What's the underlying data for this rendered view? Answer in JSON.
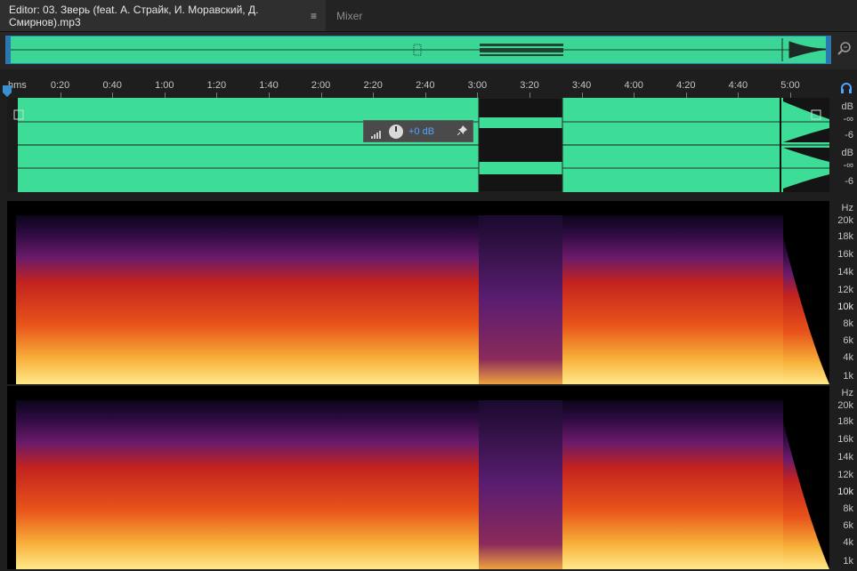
{
  "tabs": {
    "editor_label": "Editor: 03. Зверь (feat. А. Страйк, И. Моравский, Д. Смирнов).mp3",
    "menu_glyph": "≡",
    "mixer_label": "Mixer"
  },
  "ruler": {
    "unit": "hms",
    "labels": [
      "0:20",
      "0:40",
      "1:00",
      "1:20",
      "1:40",
      "2:00",
      "2:20",
      "2:40",
      "3:00",
      "3:20",
      "3:40",
      "4:00",
      "4:20",
      "4:40",
      "5:00"
    ]
  },
  "db_scale": {
    "top": [
      "dB",
      "-∞",
      "-6"
    ],
    "bottom": [
      "dB",
      "-∞",
      "-6"
    ]
  },
  "hud": {
    "gain": "+0 dB",
    "pin_glyph": "✦"
  },
  "hz_scale": {
    "top": [
      "Hz",
      "20k",
      "18k",
      "16k",
      "14k",
      "12k",
      "10k",
      "8k",
      "6k",
      "4k",
      "1k"
    ],
    "bottom": [
      "Hz",
      "20k",
      "18k",
      "16k",
      "14k",
      "12k",
      "10k",
      "8k",
      "6k",
      "4k",
      "1k"
    ]
  },
  "colors": {
    "waveform": "#3ddc97",
    "selection_accent": "#2c7fb6",
    "hud_value": "#4fa4ff"
  }
}
